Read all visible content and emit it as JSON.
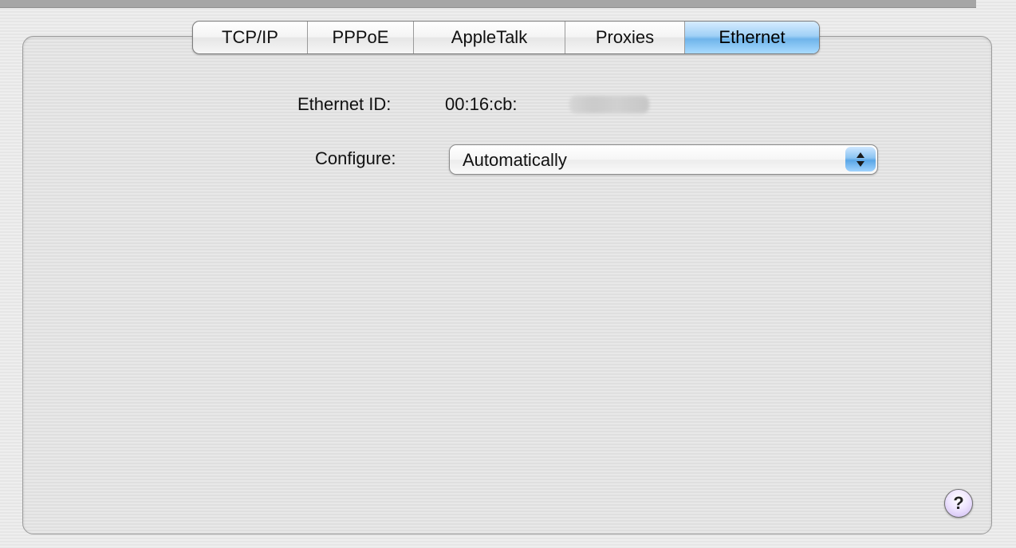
{
  "tabs": [
    {
      "label": "TCP/IP",
      "selected": false
    },
    {
      "label": "PPPoE",
      "selected": false
    },
    {
      "label": "AppleTalk",
      "selected": false
    },
    {
      "label": "Proxies",
      "selected": false
    },
    {
      "label": "Ethernet",
      "selected": true
    }
  ],
  "ethernet": {
    "id_label": "Ethernet ID:",
    "id_value": "00:16:cb:",
    "configure_label": "Configure:",
    "configure_value": "Automatically"
  },
  "help": {
    "label": "?"
  },
  "colors": {
    "selected_tab": "#8cc4f2",
    "help_button": "#cdb8f0"
  }
}
